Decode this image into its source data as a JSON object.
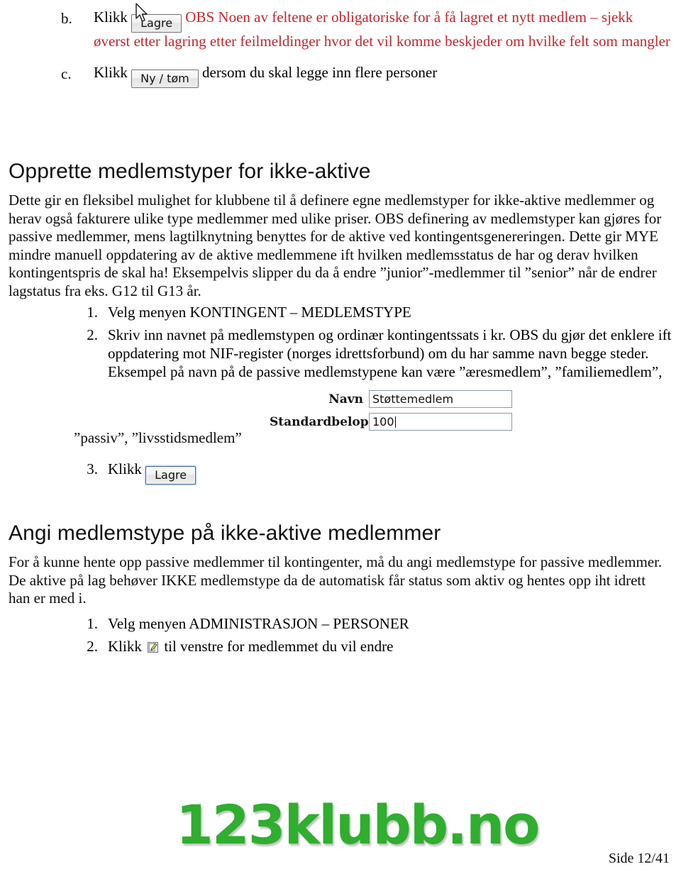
{
  "document": {
    "footer_page": "Side 12/41",
    "logo_text": "123klubb.no",
    "accent_red": "#c0272d",
    "logo_green": "#2fae2f"
  },
  "alpha_list": {
    "items": [
      {
        "marker": "b.",
        "prefix": "Klikk",
        "button_label": "Lagre",
        "red_text": "OBS Noen av feltene er obligatoriske for å få lagret et nytt medlem – sjekk øverst etter lagring etter feilmeldinger hvor det vil komme beskjeder om hvilke felt som mangler"
      },
      {
        "marker": "c.",
        "prefix": "Klikk",
        "button_label": "Ny / tøm",
        "suffix": "dersom du skal legge inn flere personer"
      }
    ]
  },
  "section_one": {
    "heading": "Opprette medlemstyper for ikke-aktive",
    "paragraph": "Dette gir en fleksibel mulighet for klubbene til å definere egne medlemstyper for ikke-aktive medlemmer og herav også fakturere ulike type medlemmer med ulike priser. OBS definering av medlemstyper kan gjøres for passive medlemmer, mens lagtilknytning benyttes for de aktive ved kontingentsgenereringen. Dette gir MYE mindre manuell oppdatering av de aktive medlemmene ift hvilken medlemsstatus de har og derav hvilken kontingentspris de skal ha! Eksempelvis slipper du da å endre ”junior”-medlemmer til ”senior” når de endrer lagstatus fra eks. G12 til G13 år.",
    "steps": [
      {
        "marker": "1.",
        "text": "Velg menyen KONTINGENT – MEDLEMSTYPE"
      },
      {
        "marker": "2.",
        "text": "Skriv inn navnet på medlemstypen og ordinær kontingentssats i kr. OBS du gjør det enklere ift oppdatering mot NIF-register (norges idrettsforbund) om du har samme navn begge steder. Eksempel på navn på de passive medlemstypene kan være ”æresmedlem”, ”familiemedlem”,"
      },
      {
        "marker": "3.",
        "prefix": "Klikk",
        "button_label": "Lagre"
      }
    ],
    "trailing_examples": "”passiv”, ”livsstidsmedlem”",
    "form": {
      "navn_label": "Navn",
      "navn_value": "Støttemedlem",
      "belop_label": "Standardbelop",
      "belop_value": "100"
    }
  },
  "section_two": {
    "heading": "Angi medlemstype på ikke-aktive medlemmer",
    "paragraph": "For å kunne hente opp passive medlemmer til kontingenter, må du angi medlemstype for passive medlemmer. De aktive på lag behøver IKKE medlemstype da de automatisk får status som aktiv og hentes opp iht idrett han er med i.",
    "steps": [
      {
        "marker": "1.",
        "text": "Velg menyen ADMINISTRASJON – PERSONER"
      },
      {
        "marker": "2.",
        "prefix": "Klikk",
        "suffix": "til venstre for medlemmet du vil endre"
      }
    ]
  }
}
